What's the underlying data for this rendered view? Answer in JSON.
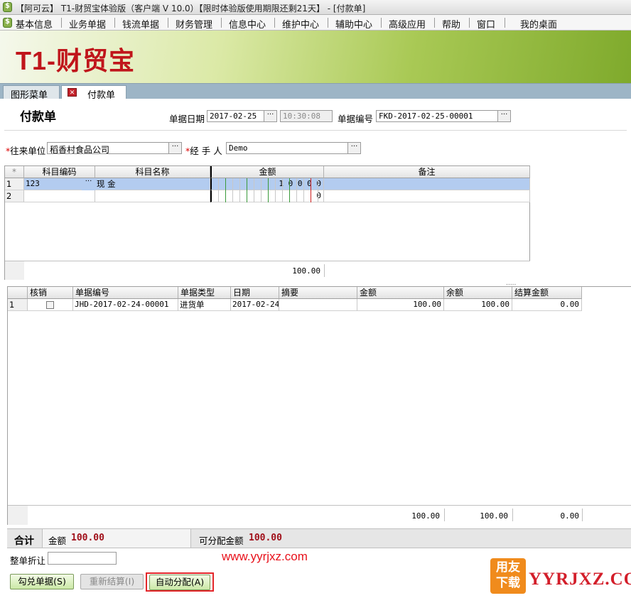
{
  "window": {
    "title": "【阿可云】 T1-财贸宝体验版（客户端 V 10.0）【限时体验版使用期限还剩21天】 - [付款单]"
  },
  "menu": [
    "基本信息",
    "业务单据",
    "钱流单据",
    "财务管理",
    "信息中心",
    "维护中心",
    "辅助中心",
    "高级应用",
    "帮助",
    "窗口",
    "我的桌面"
  ],
  "banner": {
    "logo": "T1-财贸宝"
  },
  "tabs": {
    "menu_tab": "图形菜单",
    "active_tab": "付款单"
  },
  "form": {
    "title": "付款单",
    "date_label": "单据日期",
    "date_value": "2017-02-25",
    "time_value": "10:30:08",
    "docno_label": "单据编号",
    "docno_value": "FKD-2017-02-25-00001",
    "partner_label": "往来单位",
    "partner_value": "稻香村食品公司",
    "handler_label": "经 手 人",
    "handler_value": "Demo",
    "req_mark": "*"
  },
  "grid1": {
    "corner": "*",
    "headers": [
      "科目编码",
      "科目名称",
      "金额",
      "备注"
    ],
    "rows": [
      {
        "n": "1",
        "code": "123",
        "name": "现    金",
        "amount": "1 0 0 0 0",
        "note": ""
      },
      {
        "n": "2",
        "code": "",
        "name": "",
        "amount": "0",
        "note": ""
      }
    ],
    "total": "100.00"
  },
  "grid2": {
    "headers": [
      "核销",
      "单据编号",
      "单据类型",
      "日期",
      "摘要",
      "金额",
      "余额",
      "结算金额"
    ],
    "rows": [
      {
        "n": "1",
        "docno": "JHD-2017-02-24-00001",
        "type": "进货单",
        "date": "2017-02-24",
        "summary": "",
        "amount": "100.00",
        "balance": "100.00",
        "settle": "0.00"
      }
    ],
    "totals": {
      "amount": "100.00",
      "balance": "100.00",
      "settle": "0.00"
    }
  },
  "footer": {
    "sum_label": "合计",
    "amount_label": "金额",
    "amount_value": "100.00",
    "alloc_label": "可分配金额",
    "alloc_value": "100.00",
    "discount_label": "整单折让",
    "btn_check": "勾兑单据(S)",
    "btn_recalc": "重新结算(I)",
    "btn_auto": "自动分配(A)"
  },
  "watermark": {
    "url": "www.yyrjxz.com",
    "badge": "用友下载",
    "brand": "YYRJXZ.COM"
  },
  "colors": {
    "accent_red": "#a0101a",
    "banner_green": "#7faa2c",
    "selection": "#b3ccf0"
  }
}
